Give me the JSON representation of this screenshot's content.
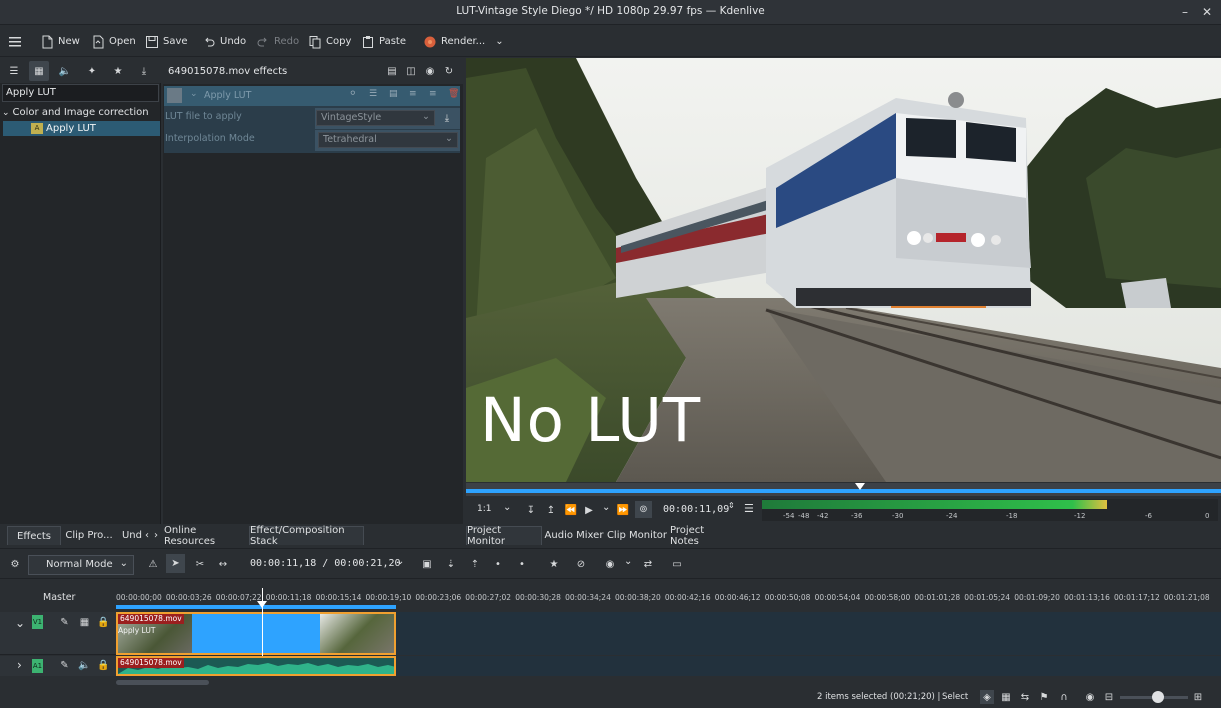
{
  "window": {
    "title": "LUT-Vintage Style Diego */ HD 1080p 29.97 fps — Kdenlive"
  },
  "toolbar": {
    "new_label": "New",
    "open_label": "Open",
    "save_label": "Save",
    "undo_label": "Undo",
    "redo_label": "Redo",
    "copy_label": "Copy",
    "paste_label": "Paste",
    "render_label": "Render..."
  },
  "effects_panel": {
    "search_value": "Apply LUT",
    "category": "Color and Image correction",
    "item": "Apply LUT",
    "item_badge": "A"
  },
  "effect_stack": {
    "header": "649015078.mov effects",
    "effect_name": "Apply LUT",
    "params": [
      {
        "label": "LUT file to apply",
        "value": "VintageStyle"
      },
      {
        "label": "Interpolation Mode",
        "value": "Tetrahedral"
      }
    ]
  },
  "monitor": {
    "overlay_text": "No LUT",
    "zoom": "1:1",
    "timecode": "00:00:11,09",
    "meter_scale": [
      "-54",
      "-48",
      "-42",
      "-36",
      "-30",
      "-24",
      "-18",
      "-12",
      "-6",
      "0"
    ]
  },
  "left_tabs": {
    "effects": "Effects",
    "clip_properties": "Clip Pro...",
    "undo": "Und",
    "online_resources": "Online Resources",
    "composition_stack": "Effect/Composition Stack"
  },
  "monitor_tabs": {
    "project_monitor": "Project Monitor",
    "audio_mixer": "Audio Mixer",
    "clip_monitor": "Clip Monitor",
    "project_notes": "Project Notes"
  },
  "timeline": {
    "mode": "Normal Mode",
    "position": "00:00:11,18 / 00:00:21,20",
    "master_label": "Master",
    "ruler_ticks": [
      "00:00:00;00",
      "00:00:03;26",
      "00:00:07;22",
      "00:00:11;18",
      "00:00:15;14",
      "00:00:19;10",
      "00:00:23;06",
      "00:00:27;02",
      "00:00:30;28",
      "00:00:34;24",
      "00:00:38;20",
      "00:00:42;16",
      "00:00:46;12",
      "00:00:50;08",
      "00:00:54;04",
      "00:00:58;00",
      "00:01:01;28",
      "00:01:05;24",
      "00:01:09;20",
      "00:01:13;16",
      "00:01:17;12",
      "00:01:21;08"
    ],
    "v1_tag": "V1",
    "a1_tag": "A1",
    "clip_name": "649015078.mov",
    "clip_effect": "Apply LUT",
    "audio_clip_name": "649015078.mov"
  },
  "status": {
    "selection": "2 items selected (00:21;20) |",
    "tool": "Select"
  },
  "colors": {
    "accent": "#2ea3ff",
    "selection": "#2c5b74",
    "clip_label": "#9a1f1f",
    "audio_wave": "#2fb38a",
    "clip_border": "#f0a030"
  }
}
